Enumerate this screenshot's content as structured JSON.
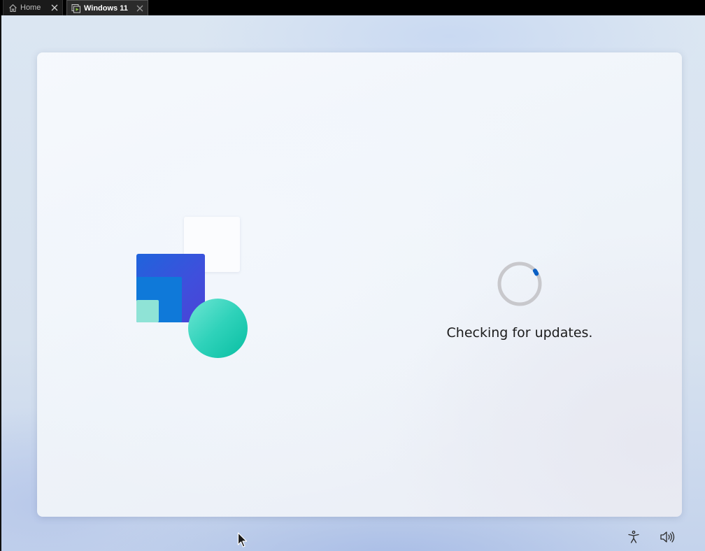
{
  "tabs": [
    {
      "label": "Home",
      "icon": "home-icon",
      "active": false
    },
    {
      "label": "Windows 11",
      "icon": "vm-icon",
      "active": true
    }
  ],
  "main": {
    "status_text": "Checking for updates."
  },
  "bottom_bar": {
    "icons": [
      "accessibility-icon",
      "volume-icon"
    ]
  },
  "colors": {
    "spinner_track": "#c8c8cc",
    "spinner_accent": "#0a5fc4",
    "vm_icon_accent": "#8cc63f"
  }
}
